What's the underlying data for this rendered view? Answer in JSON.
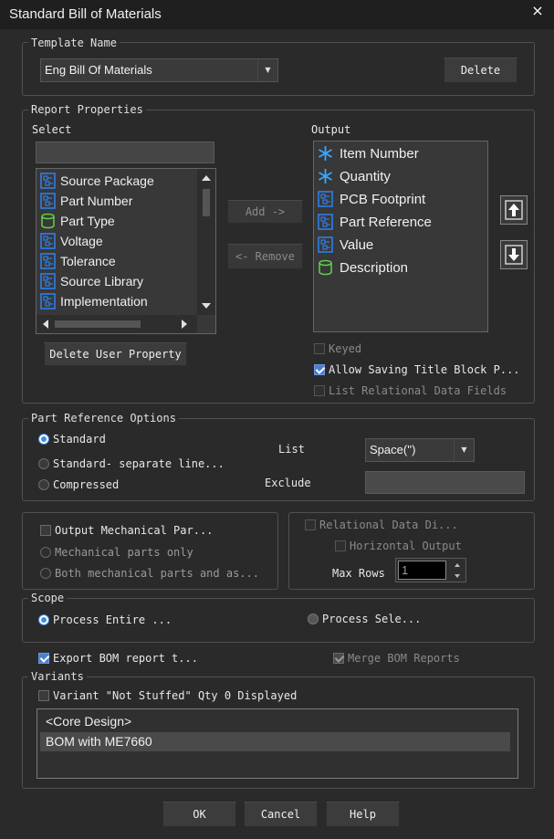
{
  "window": {
    "title": "Standard Bill of Materials",
    "close_glyph": "×"
  },
  "template": {
    "legend": "Template Name",
    "selected": "Eng Bill Of Materials",
    "delete_label": "Delete"
  },
  "report": {
    "legend": "Report Properties",
    "select_label": "Select",
    "output_label": "Output",
    "search_value": "",
    "select_items": [
      {
        "label": "Source Package",
        "icon": "property-icon"
      },
      {
        "label": "Part Number",
        "icon": "property-icon"
      },
      {
        "label": "Part Type",
        "icon": "cylinder-icon"
      },
      {
        "label": "Voltage",
        "icon": "property-icon"
      },
      {
        "label": "Tolerance",
        "icon": "property-icon"
      },
      {
        "label": "Source Library",
        "icon": "property-icon"
      },
      {
        "label": "Implementation",
        "icon": "property-icon"
      }
    ],
    "output_items": [
      {
        "label": "Item Number",
        "icon": "asterisk-icon"
      },
      {
        "label": "Quantity",
        "icon": "asterisk-icon"
      },
      {
        "label": "PCB Footprint",
        "icon": "property-icon"
      },
      {
        "label": "Part Reference",
        "icon": "property-icon"
      },
      {
        "label": "Value",
        "icon": "property-icon"
      },
      {
        "label": "Description",
        "icon": "cylinder-icon"
      }
    ],
    "add_label": "Add ->",
    "remove_label": "<- Remove",
    "delete_user_property_label": "Delete User Property",
    "keyed_label": "Keyed",
    "allow_saving_label": "Allow Saving Title Block P...",
    "list_relational_label": "List Relational Data Fields"
  },
  "part_reference": {
    "legend": "Part Reference Options",
    "standard_label": "Standard",
    "separate_label": "Standard- separate line...",
    "compressed_label": "Compressed",
    "list_label": "List",
    "list_value": "Space('')",
    "exclude_label": "Exclude",
    "exclude_value": ""
  },
  "mechanical": {
    "output_label": "Output Mechanical Par...",
    "only_label": "Mechanical parts only",
    "both_label": "Both mechanical parts and as..."
  },
  "relational": {
    "label": "Relational Data Di...",
    "horizontal_label": "Horizontal Output",
    "max_rows_label": "Max Rows",
    "max_rows_value": "1"
  },
  "scope": {
    "legend": "Scope",
    "entire_label": "Process Entire ...",
    "selection_label": "Process Sele..."
  },
  "export": {
    "export_label": "Export BOM report t...",
    "merge_label": "Merge BOM Reports"
  },
  "variants": {
    "legend": "Variants",
    "not_stuffed_label": "Variant \"Not Stuffed\" Qty 0 Displayed",
    "items": [
      "<Core Design>",
      "BOM with ME7660"
    ]
  },
  "footer": {
    "ok_label": "OK",
    "cancel_label": "Cancel",
    "help_label": "Help"
  },
  "colors": {
    "accent": "#3a8ee6",
    "asterisk": "#3aa8ff",
    "property_icon": "#2f7fe8",
    "cylinder_icon": "#5fd34a"
  }
}
